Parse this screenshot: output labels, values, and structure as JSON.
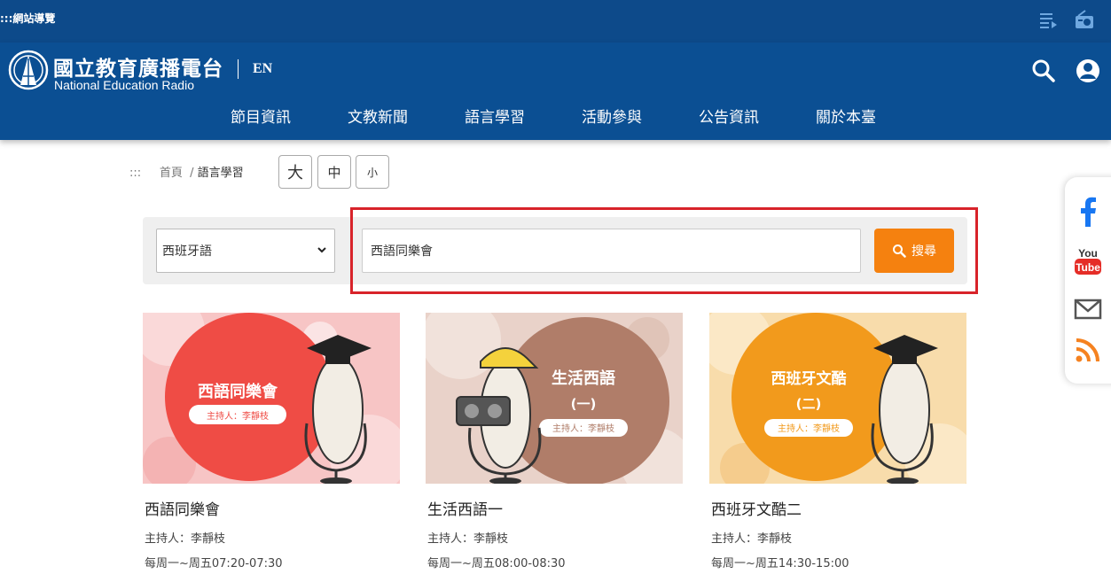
{
  "topbar": {
    "sitemap": ":::網站導覽"
  },
  "header": {
    "logo_cn": "國立教育廣播電台",
    "logo_en": "National Education Radio",
    "lang": "EN"
  },
  "nav": [
    "節目資訊",
    "文教新聞",
    "語言學習",
    "活動參與",
    "公告資訊",
    "關於本臺"
  ],
  "breadcrumb": {
    "prefix": ":::",
    "home": "首頁",
    "sep": "/",
    "current": "語言學習"
  },
  "font_size": {
    "large": "大",
    "medium": "中",
    "small": "小"
  },
  "search": {
    "language": "西班牙語",
    "query": "西語同樂會",
    "button": "搜尋"
  },
  "cards": [
    {
      "title": "西語同樂會",
      "host": "主持人：李靜枝",
      "time": "每周一~周五07:20-07:30",
      "thumb_title": "西語同樂會",
      "thumb_sub": "",
      "thumb_host": "主持人：李靜枝"
    },
    {
      "title": "生活西語一",
      "host": "主持人：李靜枝",
      "time": "每周一~周五08:00-08:30",
      "thumb_title": "生活西語",
      "thumb_sub": "(一)",
      "thumb_host": "主持人：李靜枝"
    },
    {
      "title": "西班牙文酷二",
      "host": "主持人：李靜枝",
      "time": "每周一~周五14:30-15:00",
      "thumb_title": "西班牙文酷",
      "thumb_sub": "(二)",
      "thumb_host": "主持人：李靜枝"
    }
  ],
  "social": {
    "youtube_top": "You",
    "youtube_bottom": "Tube"
  },
  "colors": {
    "brand_blue": "#0b4f93",
    "orange": "#f5810f",
    "highlight_red": "#d8232a"
  }
}
